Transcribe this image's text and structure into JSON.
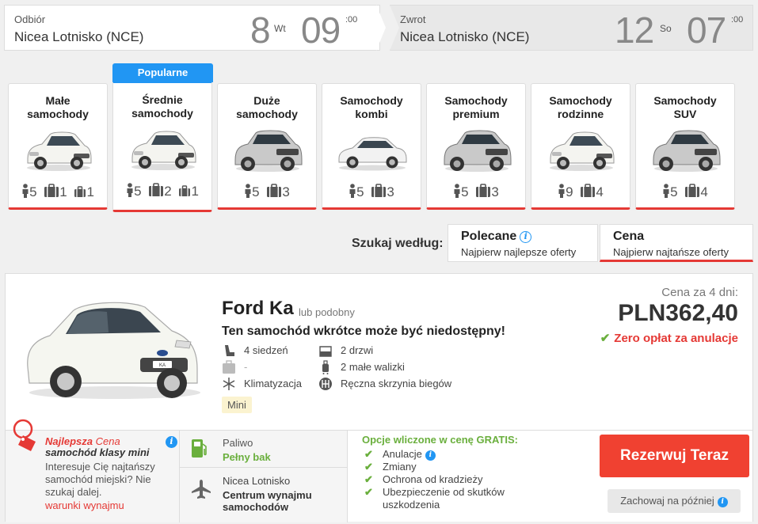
{
  "pickup": {
    "label": "Odbiór",
    "location": "Nicea Lotnisko (NCE)",
    "day": "8",
    "dow": "Wt",
    "hour": "09",
    "min": ":00"
  },
  "dropoff": {
    "label": "Zwrot",
    "location": "Nicea Lotnisko (NCE)",
    "day": "12",
    "dow": "So",
    "hour": "07",
    "min": ":00"
  },
  "popular_badge": "Popularne",
  "categories": [
    {
      "title": "Małe samochody",
      "seats": "5",
      "big": "1",
      "small": "1"
    },
    {
      "title": "Średnie samochody",
      "seats": "5",
      "big": "2",
      "small": "1"
    },
    {
      "title": "Duże samochody",
      "seats": "5",
      "bags": "3"
    },
    {
      "title": "Samochody kombi",
      "seats": "5",
      "bags": "3"
    },
    {
      "title": "Samochody premium",
      "seats": "5",
      "bags": "3"
    },
    {
      "title": "Samochody rodzinne",
      "seats": "9",
      "bags": "4"
    },
    {
      "title": "Samochody SUV",
      "seats": "5",
      "bags": "4"
    }
  ],
  "sort": {
    "label": "Szukaj według:",
    "options": [
      {
        "title": "Polecane",
        "subtitle": "Najpierw najlepsze oferty"
      },
      {
        "title": "Cena",
        "subtitle": "Najpierw najtańsze oferty"
      }
    ]
  },
  "offer": {
    "name": "Ford Ka",
    "similar": "lub podobny",
    "availability": "Ten samochód wkrótce może być niedostępny!",
    "features": {
      "seats": "4 siedzeń",
      "doors": "2 drzwi",
      "big_bags": "-",
      "small_bags": "2 małe walizki",
      "ac": "Klimatyzacja",
      "gearbox": "Ręczna skrzynia biegów"
    },
    "car_class": "Mini",
    "price_label": "Cena za 4 dni:",
    "price": "PLN362,40",
    "free_cancel": "Zero opłat za anulacje",
    "deal": {
      "title_a": "Najlepsza",
      "title_b": "Cena",
      "title_c": "samochód klasy mini",
      "desc": "Interesuje Cię najtańszy samochód miejski? Nie szukaj dalej.",
      "link": "warunki wynajmu"
    },
    "fuel": {
      "label": "Paliwo",
      "value": "Pełny bak"
    },
    "location": {
      "label": "Nicea Lotnisko",
      "value": "Centrum wynajmu samochodów"
    },
    "included": {
      "title": "Opcje wliczone w cenę GRATIS:",
      "items": [
        "Anulacje",
        "Zmiany",
        "Ochrona od kradzieży",
        "Ubezpieczenie od skutków uszkodzenia"
      ]
    },
    "reserve_button": "Rezerwuj Teraz",
    "save_button": "Zachowaj na później"
  },
  "colors": {
    "accent_red": "#f04131",
    "accent_blue": "#2196f3",
    "green": "#6aaf3d"
  }
}
